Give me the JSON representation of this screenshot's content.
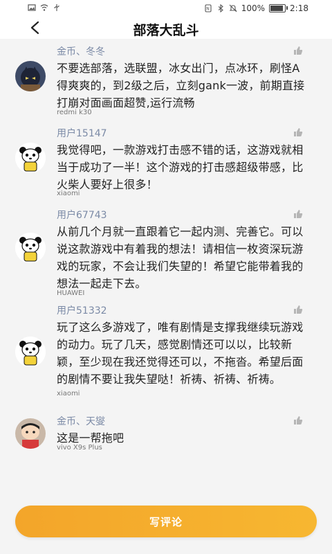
{
  "status_bar": {
    "battery_text": "100%",
    "battery_level": 1.0,
    "time": "2:18"
  },
  "header": {
    "title": "部落大乱斗"
  },
  "comments": [
    {
      "user": "金币、冬冬",
      "text": "不要选部落，选联盟，冰女出门，点冰环，刷怪A得爽爽的，到2级之后，立刻gank一波，前期直接打崩对面画面超赞,运行流畅",
      "device": "redmi k30",
      "avatar": "dark-hero-avatar"
    },
    {
      "user": "用户15147",
      "text": "我觉得吧，一款游戏打击感不错的话，这游戏就相当于成功了一半！这个游戏的打击感超级带感，比火柴人要好上很多！",
      "device": "xiaomi",
      "avatar": "panda-avatar"
    },
    {
      "user": "用户67743",
      "text": "从前几个月就一直跟着它一起内测、完善它。可以说这款游戏中有着我的想法！请相信一枚资深玩游戏的玩家，不会让我们失望的！希望它能带着我的想法一起走下去。",
      "device": "HUAWEI",
      "avatar": "panda-avatar"
    },
    {
      "user": "用户51332",
      "text": "玩了这么多游戏了，唯有剧情是支撑我继续玩游戏的动力。玩了几天，感觉剧情还可以以，比较新颖，至少现在我还觉得还可以，不拖沓。希望后面的剧情不要让我失望哒！祈祷、祈祷、祈祷。",
      "device": "xiaomi",
      "avatar": "panda-avatar"
    },
    {
      "user": "金币、天燮",
      "text": "这是一帮拖吧",
      "device": "vivo X9s Plus",
      "avatar": "cartoon-kid-avatar"
    }
  ],
  "footer": {
    "write_comment_label": "写评论"
  },
  "colors": {
    "accent": "#f5a623",
    "username": "#7b8aa6",
    "background": "#f4f4f4"
  }
}
